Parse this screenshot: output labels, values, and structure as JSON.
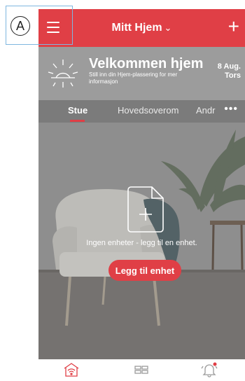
{
  "annotation": {
    "label": "A"
  },
  "header": {
    "title": "Mitt Hjem",
    "title_chevron": "⌄",
    "add_symbol": "+"
  },
  "welcome": {
    "title": "Velkommen hjem",
    "subtitle": "Still inn din Hjem-plassering for mer informasjon",
    "date_day": "8 Aug.",
    "date_weekday": "Tors"
  },
  "tabs": [
    {
      "label": "Stue",
      "active": true
    },
    {
      "label": "Hovedsoverom",
      "active": false
    },
    {
      "label": "Andr",
      "active": false
    }
  ],
  "tabs_more": "•••",
  "main": {
    "empty_message": "Ingen enheter - legg til en enhet.",
    "add_device_label": "Legg til enhet"
  },
  "nav": [
    {
      "icon": "home-wifi-icon",
      "active": true
    },
    {
      "icon": "grid-icon",
      "active": false
    },
    {
      "icon": "bell-icon",
      "active": false,
      "badge": true
    }
  ],
  "colors": {
    "accent": "#e03f46",
    "welcome_bg": "#9c9c9c",
    "tabs_bg": "#7b7b7b"
  }
}
